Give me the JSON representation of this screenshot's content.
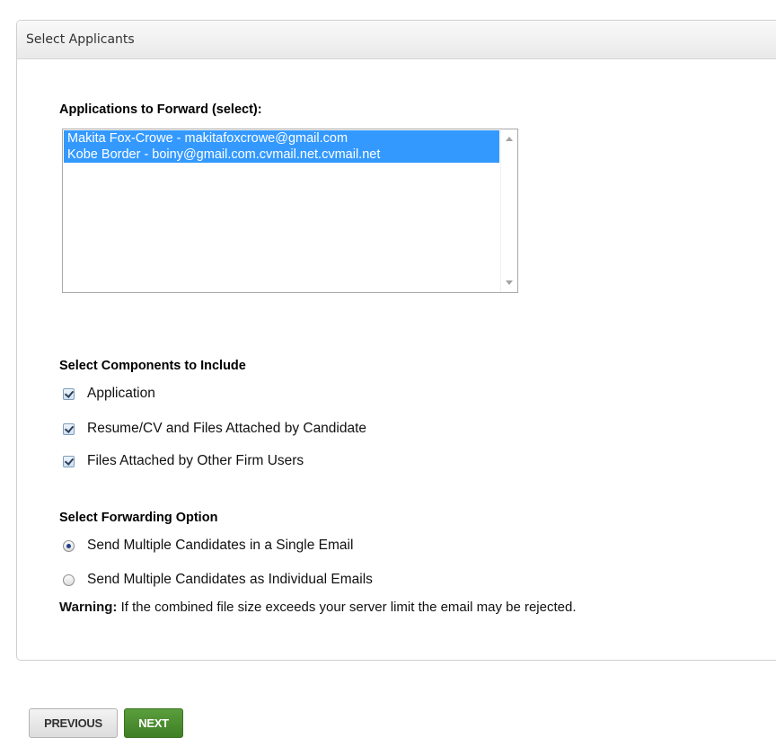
{
  "panel": {
    "title": "Select Applicants"
  },
  "applications": {
    "heading": "Applications to Forward (select):",
    "options": [
      "Makita Fox-Crowe - makitafoxcrowe@gmail.com",
      "Kobe Border - boiny@gmail.com.cvmail.net.cvmail.net"
    ]
  },
  "components": {
    "heading": "Select Components to Include",
    "items": [
      {
        "label": "Application",
        "checked": true
      },
      {
        "label": "Resume/CV and Files Attached by Candidate",
        "checked": true
      },
      {
        "label": "Files Attached by Other Firm Users",
        "checked": true
      }
    ]
  },
  "forwarding": {
    "heading": "Select Forwarding Option",
    "options": [
      {
        "label": "Send Multiple Candidates in a Single Email",
        "selected": true
      },
      {
        "label": "Send Multiple Candidates as Individual Emails",
        "selected": false
      }
    ]
  },
  "warning": {
    "label": "Warning:",
    "text": " If the combined file size exceeds your server limit the email may be rejected."
  },
  "buttons": {
    "previous": "PREVIOUS",
    "next": "NEXT"
  },
  "colors": {
    "selection": "#3399ff",
    "next_button": "#4a8c2e"
  }
}
